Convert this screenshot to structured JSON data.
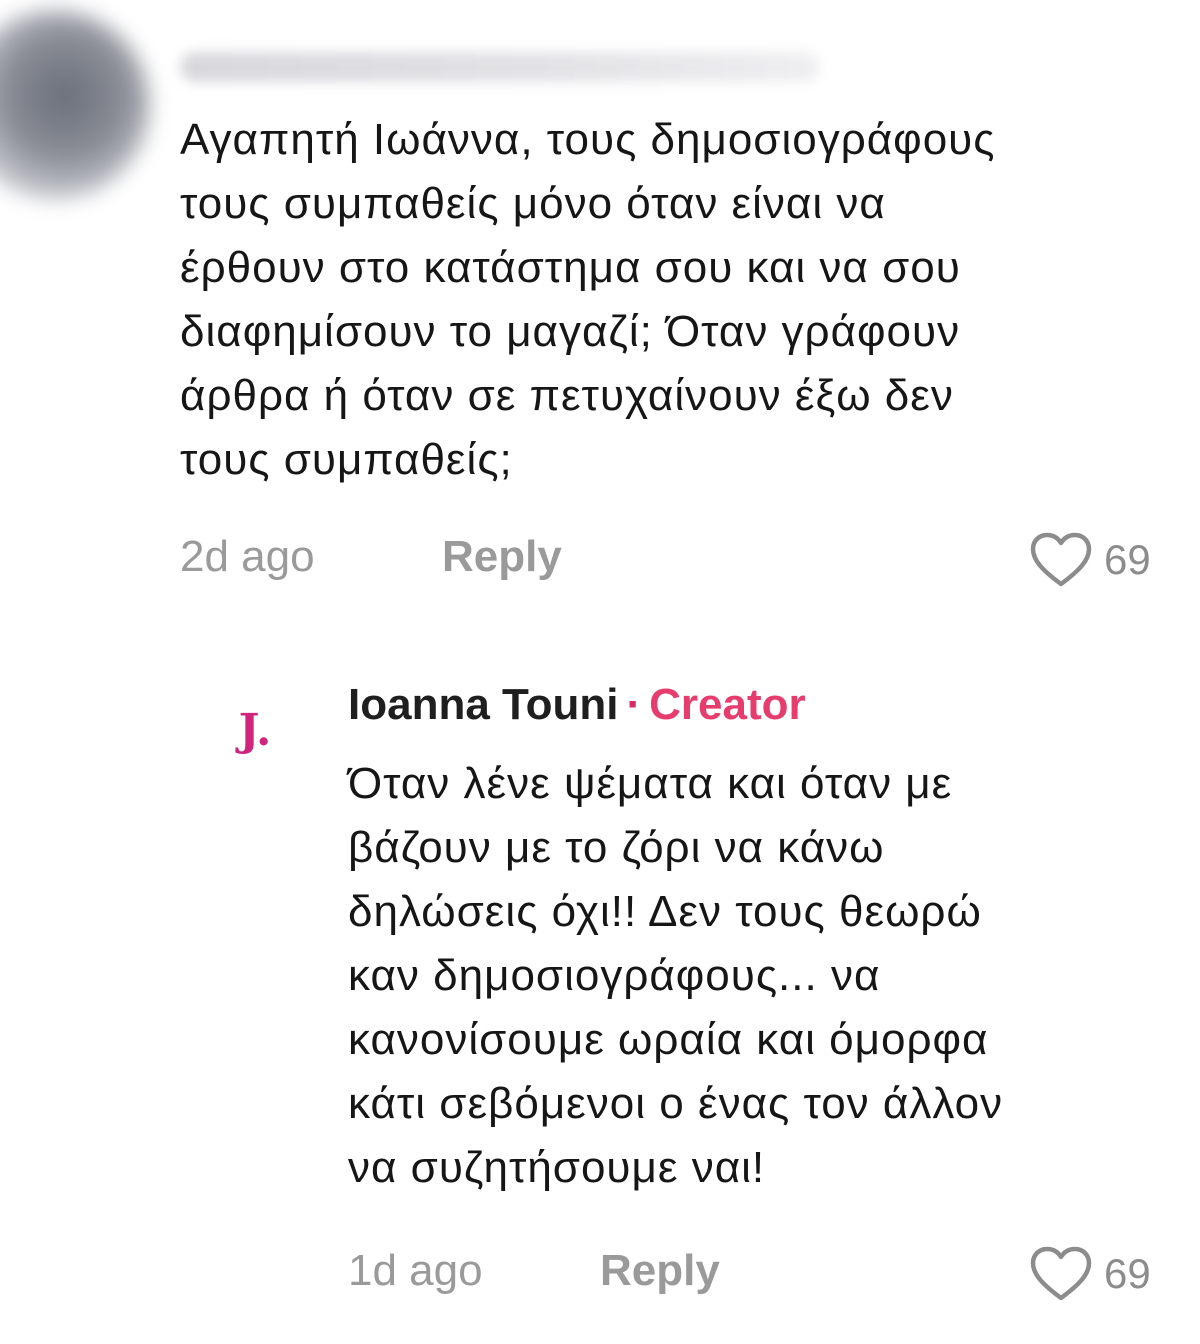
{
  "comments": [
    {
      "text": "Αγαπητή Ιωάννα, τους δημοσιογράφους\nτους συμπαθείς μόνο όταν είναι να\nέρθουν στο κατάστημα σου και να σου\nδιαφημίσουν το μαγαζί; Όταν γράφουν\nάρθρα ή όταν σε πετυχαίνουν έξω δεν\nτους συμπαθείς;",
      "time": "2d ago",
      "reply_label": "Reply",
      "likes": "69",
      "like_icon": "heart-outline-icon"
    },
    {
      "avatar_letter": "J.",
      "author": "Ioanna Touni",
      "separator": "·",
      "badge": "Creator",
      "text": "Όταν λένε ψέματα και όταν με\nβάζουν με το ζόρι να κάνω\nδηλώσεις όχι!! Δεν τους θεωρώ\nκαν δημοσιογράφους... να\nκανονίσουμε ωραία και όμορφα\nκάτι σεβόμενοι ο ένας τον άλλον\nνα συζητήσουμε ναι!",
      "time": "1d ago",
      "reply_label": "Reply",
      "likes": "69",
      "like_icon": "heart-outline-icon"
    }
  ],
  "colors": {
    "creator_badge": "#e63d6e",
    "avatar_letter": "#d0247d",
    "meta_text": "#9a9a9a"
  }
}
